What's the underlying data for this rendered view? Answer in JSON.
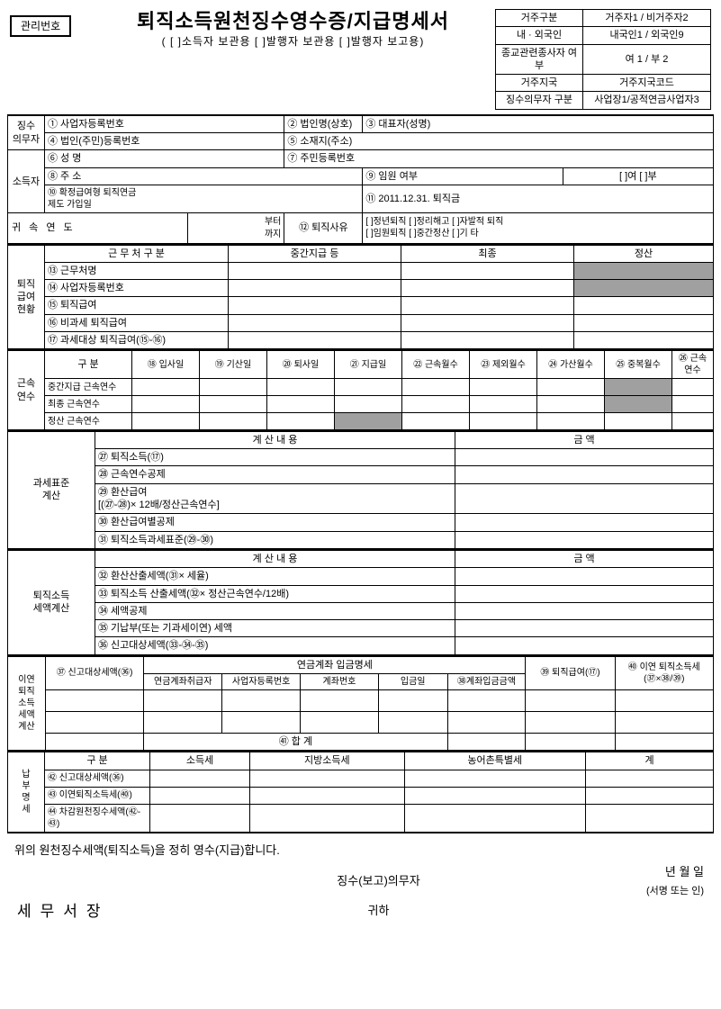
{
  "header": {
    "mgmt_label": "관리번호",
    "title": "퇴직소득원천징수영수증/지급명세서",
    "subtitle": "( [ ]소득자 보관용   [ ]발행자 보관용   [ ]발행자 보고용)",
    "info_rows": {
      "r1a": "거주구분",
      "r1b": "거주자1 / 비거주자2",
      "r2a": "내 · 외국인",
      "r2b": "내국인1 / 외국인9",
      "r3a": "종교관련종사자 여부",
      "r3b": "여 1 / 부 2",
      "r4a": "거주지국",
      "r4b": "거주지국코드",
      "r5a": "징수의무자 구분",
      "r5b": "사업장1/공적연금사업자3"
    }
  },
  "sec1": {
    "label": "징수\n의무자",
    "r1": "① 사업자등록번호",
    "r2": "② 법인명(상호)",
    "r3": "③ 대표자(성명)",
    "r4": "④ 법인(주민)등록번호",
    "r5": "⑤ 소재지(주소)"
  },
  "sec2": {
    "label": "소득자",
    "r6": "⑥ 성            명",
    "r7": "⑦ 주민등록번호",
    "r8": "⑧ 주            소",
    "r9": "⑨ 임원 여부",
    "r9v": "[   ]여  [   ]부",
    "r10": "⑩   확정급여형 퇴직연금\n      제도 가입일",
    "r11": "⑪ 2011.12.31. 퇴직금"
  },
  "sec3": {
    "year": "귀 속 연 도",
    "from": "부터",
    "to": "까지",
    "r12": "⑫ 퇴직사유",
    "opts": "[  ]정년퇴직    [  ]정리해고    [  ]자발적 퇴직\n[  ]임원퇴직    [  ]중간정산    [  ]기 타"
  },
  "sec4": {
    "label": "퇴직\n급여\n현황",
    "h1": "근 무 처 구 분",
    "h2": "중간지급 등",
    "h3": "최종",
    "h4": "정산",
    "r13": "⑬ 근무처명",
    "r14": "⑭ 사업자등록번호",
    "r15": "⑮ 퇴직급여",
    "r16": "⑯ 비과세 퇴직급여",
    "r17": "⑰ 과세대상 퇴직급여(⑮-⑯)"
  },
  "sec5": {
    "label": "근속\n연수",
    "h1": "구    분",
    "h18": "⑱ 입사일",
    "h19": "⑲ 기산일",
    "h20": "⑳ 퇴사일",
    "h21": "㉑ 지급일",
    "h22": "㉒ 근속월수",
    "h23": "㉓ 제외월수",
    "h24": "㉔ 가산월수",
    "h25": "㉕ 중복월수",
    "h26": "㉖ 근속연수",
    "r1": "중간지급 근속연수",
    "r2": "최종 근속연수",
    "r3": "정산 근속연수"
  },
  "sec6": {
    "label": "과세표준\n계산",
    "h1": "계 산 내 용",
    "h2": "금    액",
    "r27": "㉗ 퇴직소득(⑰)",
    "r28": "㉘ 근속연수공제",
    "r29": "㉙ 환산급여\n     [(㉗-㉘)× 12배/정산근속연수]",
    "r30": "㉚ 환산급여별공제",
    "r31": "㉛ 퇴직소득과세표준(㉙-㉚)"
  },
  "sec7": {
    "label": "퇴직소득\n세액계산",
    "h1": "계 산 내 용",
    "h2": "금    액",
    "r32": "㉜ 환산산출세액(㉛× 세율)",
    "r33": "㉝ 퇴직소득 산출세액(㉜× 정산근속연수/12배)",
    "r34": "㉞ 세액공제",
    "r35": "㉟ 기납부(또는 기과세이연) 세액",
    "r36": "㊱ 신고대상세액(㉝-㉞-㉟)"
  },
  "sec8": {
    "label": "이연\n퇴직\n소득\n세액\n계산",
    "r37": "㊲ 신고대상세액(㊱)",
    "h_group": "연금계좌 입금명세",
    "h1": "연금계좌취급자",
    "h2": "사업자등록번호",
    "h3": "계좌번호",
    "h4": "입금일",
    "h38": "㊳계좌입금금액",
    "r39": "㊴ 퇴직급여(⑰)",
    "r40": "㊵ 이연 퇴직소득세\n(㊲×㊳/㊴)",
    "sum": "㊶  합      계"
  },
  "sec9": {
    "label": "납\n부\n명\n세",
    "h1": "구              분",
    "h2": "소득세",
    "h3": "지방소득세",
    "h4": "농어촌특별세",
    "h5": "계",
    "r42": "㊷ 신고대상세액(㊱)",
    "r43": "㊸ 이연퇴직소득세(㊵)",
    "r44": "㊹ 차감원천징수세액(㊷-㊸)"
  },
  "footer": {
    "stmt": "위의 원천징수세액(퇴직소득)을 정히 영수(지급)합니다.",
    "date": "년         월         일",
    "obl": "징수(보고)의무자",
    "sign": "(서명 또는 인)",
    "office": "세무서장",
    "to": "귀하"
  }
}
